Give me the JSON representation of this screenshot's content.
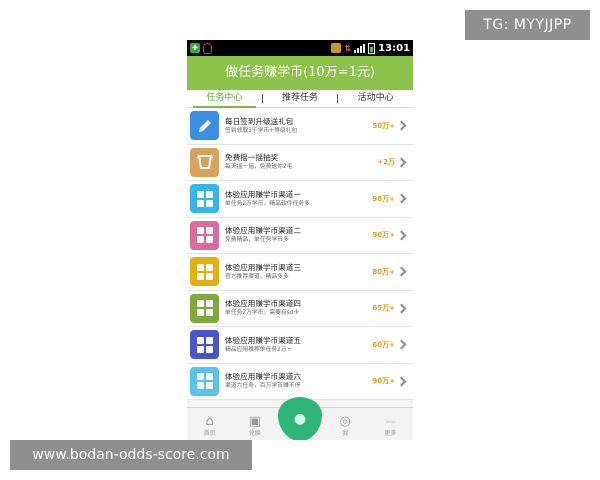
{
  "watermarks": {
    "top_right": "TG: MYYJJPP",
    "bottom_left": "www.bodan-odds-score.com"
  },
  "statusbar": {
    "time": "13:01",
    "icons": [
      "shield-icon",
      "qq-penguin-icon",
      "tool-icon",
      "data-arrows-icon",
      "signal-icon",
      "battery-icon"
    ]
  },
  "header": {
    "title": "做任务赚学币(10万=1元)"
  },
  "tabs": [
    {
      "label": "任务中心",
      "active": true
    },
    {
      "label": "推荐任务",
      "active": false
    },
    {
      "label": "活动中心",
      "active": false
    }
  ],
  "tasks": [
    {
      "title": "每日签到升级送礼包",
      "subtitle": "签到领取3千学币+等级礼包",
      "reward": "50万+",
      "icon": "pencil-icon",
      "color": "#3a8fe0"
    },
    {
      "title": "免费摇一摇抽奖",
      "subtitle": "每天摇一摇，免费送你2毛",
      "reward": "+2万",
      "icon": "shake-cup-icon",
      "color": "#d9a25a"
    },
    {
      "title": "体验应用赚学币渠道一",
      "subtitle": "单任务2万学币，精品软件任务多",
      "reward": "98万+",
      "icon": "grid-icon",
      "color": "#35b6e8"
    },
    {
      "title": "体验应用赚学币渠道二",
      "subtitle": "免费精品，单任务学币多",
      "reward": "50万+",
      "icon": "grid-icon",
      "color": "#d96b9f"
    },
    {
      "title": "体验应用赚学币渠道三",
      "subtitle": "官方推荐渠道，精品多多",
      "reward": "80万+",
      "icon": "grid-icon",
      "color": "#e3b011"
    },
    {
      "title": "体验应用赚学币渠道四",
      "subtitle": "单任务2万学币，需要有sd卡",
      "reward": "65万+",
      "icon": "grid-icon",
      "color": "#7fa93c"
    },
    {
      "title": "体验应用赚学币渠道五",
      "subtitle": "精品应用推荐单任务2万+",
      "reward": "60万+",
      "icon": "grid-icon",
      "color": "#4a55c9"
    },
    {
      "title": "体验应用赚学币渠道六",
      "subtitle": "渠道六任务，百万学币赚不停",
      "reward": "90万+",
      "icon": "grid-icon",
      "color": "#58c3ec"
    }
  ],
  "bottomnav": [
    {
      "label": "首页",
      "icon": "home-icon"
    },
    {
      "label": "兑换",
      "icon": "gift-icon"
    },
    {
      "label": "",
      "icon": "center-action-icon"
    },
    {
      "label": "我",
      "icon": "user-icon"
    },
    {
      "label": "更多",
      "icon": "more-icon"
    }
  ]
}
